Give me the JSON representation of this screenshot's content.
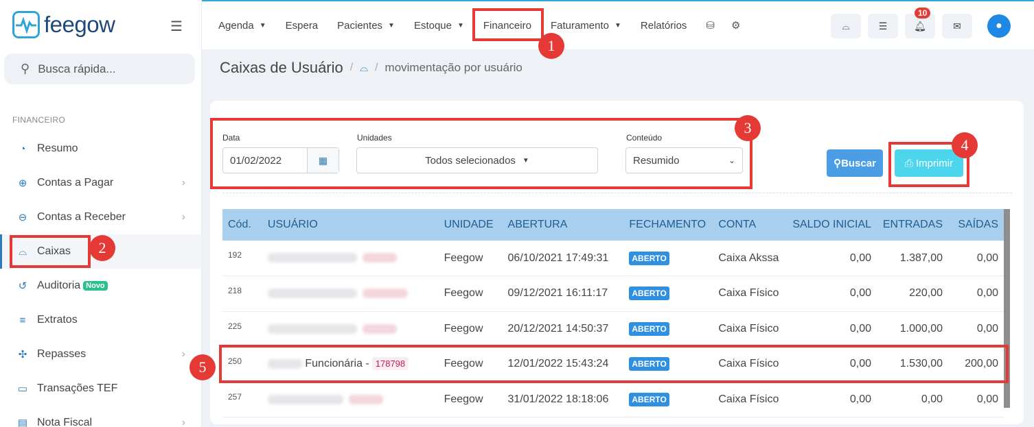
{
  "sidebar": {
    "logo_text": "feegow",
    "search_placeholder": "Busca rápida...",
    "section": "FINANCEIRO",
    "items": [
      {
        "label": "Resumo",
        "icon": "chart-pie-icon"
      },
      {
        "label": "Contas a Pagar",
        "icon": "arrow-up-circle-icon"
      },
      {
        "label": "Contas a Receber",
        "icon": "arrow-down-circle-icon"
      },
      {
        "label": "Caixas",
        "icon": "inbox-icon"
      },
      {
        "label": "Auditoria",
        "icon": "history-icon",
        "badge": "Novo"
      },
      {
        "label": "Extratos",
        "icon": "list-icon"
      },
      {
        "label": "Repasses",
        "icon": "puzzle-icon"
      },
      {
        "label": "Transações TEF",
        "icon": "card-icon"
      },
      {
        "label": "Nota Fiscal",
        "icon": "file-icon"
      }
    ]
  },
  "topnav": {
    "agenda": "Agenda",
    "espera": "Espera",
    "pacientes": "Pacientes",
    "estoque": "Estoque",
    "financeiro": "Financeiro",
    "faturamento": "Faturamento",
    "relatorios": "Relatórios",
    "notifications": "10"
  },
  "page": {
    "title": "Caixas de Usuário",
    "breadcrumb": "movimentação por usuário"
  },
  "filters": {
    "data_label": "Data",
    "data_value": "01/02/2022",
    "unidades_label": "Unidades",
    "unidades_value": "Todos selecionados",
    "conteudo_label": "Conteúdo",
    "conteudo_value": "Resumido",
    "buscar": "Buscar",
    "imprimir": "Imprimir"
  },
  "table": {
    "headers": [
      "Cód.",
      "USUÁRIO",
      "UNIDADE",
      "ABERTURA",
      "FECHAMENTO",
      "CONTA",
      "SALDO INICIAL",
      "ENTRADAS",
      "SAÍDAS"
    ],
    "rows": [
      {
        "cod": "192",
        "usuario": "",
        "id": "",
        "unidade": "Feegow",
        "abertura": "06/10/2021 17:49:31",
        "fechamento": "ABERTO",
        "conta": "Caixa Akssa",
        "saldo": "0,00",
        "entradas": "1.387,00",
        "saidas": "0,00"
      },
      {
        "cod": "218",
        "usuario": "",
        "id": "",
        "unidade": "Feegow",
        "abertura": "09/12/2021 16:11:17",
        "fechamento": "ABERTO",
        "conta": "Caixa Físico",
        "saldo": "0,00",
        "entradas": "220,00",
        "saidas": "0,00"
      },
      {
        "cod": "225",
        "usuario": "",
        "id": "",
        "unidade": "Feegow",
        "abertura": "20/12/2021 14:50:37",
        "fechamento": "ABERTO",
        "conta": "Caixa Físico",
        "saldo": "0,00",
        "entradas": "1.000,00",
        "saidas": "0,00"
      },
      {
        "cod": "250",
        "usuario": "Funcionária -",
        "id": "178798",
        "unidade": "Feegow",
        "abertura": "12/01/2022 15:43:24",
        "fechamento": "ABERTO",
        "conta": "Caixa Físico",
        "saldo": "0,00",
        "entradas": "1.530,00",
        "saidas": "200,00"
      },
      {
        "cod": "257",
        "usuario": "",
        "id": "",
        "unidade": "Feegow",
        "abertura": "31/01/2022 18:18:06",
        "fechamento": "ABERTO",
        "conta": "Caixa Físico",
        "saldo": "0,00",
        "entradas": "0,00",
        "saidas": "0,00"
      }
    ]
  },
  "annotations": [
    "1",
    "2",
    "3",
    "4",
    "5"
  ],
  "colors": {
    "accent": "#2a7bbf",
    "annotation": "#e53935",
    "header_bg": "#a8d0ee"
  }
}
